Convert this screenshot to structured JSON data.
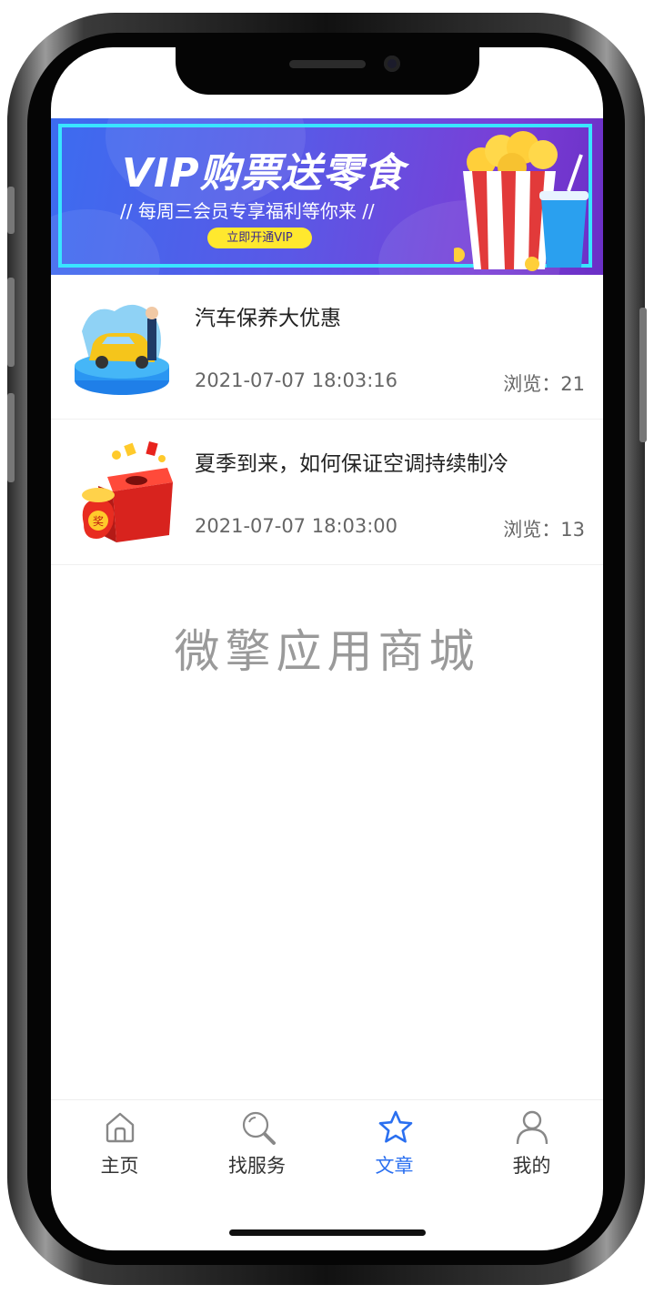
{
  "banner": {
    "title": "VIP购票送零食",
    "subtitle": "// 每周三会员专享福利等你来 //",
    "button": "立即开通VIP",
    "colors": {
      "start": "#3c6cf0",
      "end": "#7a3ed6",
      "frame": "#39e5ff",
      "button": "#ffe82e"
    }
  },
  "articles": [
    {
      "title": "汽车保养大优惠",
      "time": "2021-07-07 18:03:16",
      "views": "浏览：21",
      "icon": "car-icon"
    },
    {
      "title": "夏季到来，如何保证空调持续制冷",
      "time": "2021-07-07 18:03:00",
      "views": "浏览：13",
      "icon": "gift-box-icon"
    }
  ],
  "watermark": "微擎应用商城",
  "tabbar": {
    "active": "文章",
    "accent": "#2a6ff0",
    "items": [
      {
        "label": "主页",
        "icon": "home-icon"
      },
      {
        "label": "找服务",
        "icon": "search-icon"
      },
      {
        "label": "文章",
        "icon": "star-icon"
      },
      {
        "label": "我的",
        "icon": "user-icon"
      }
    ]
  }
}
